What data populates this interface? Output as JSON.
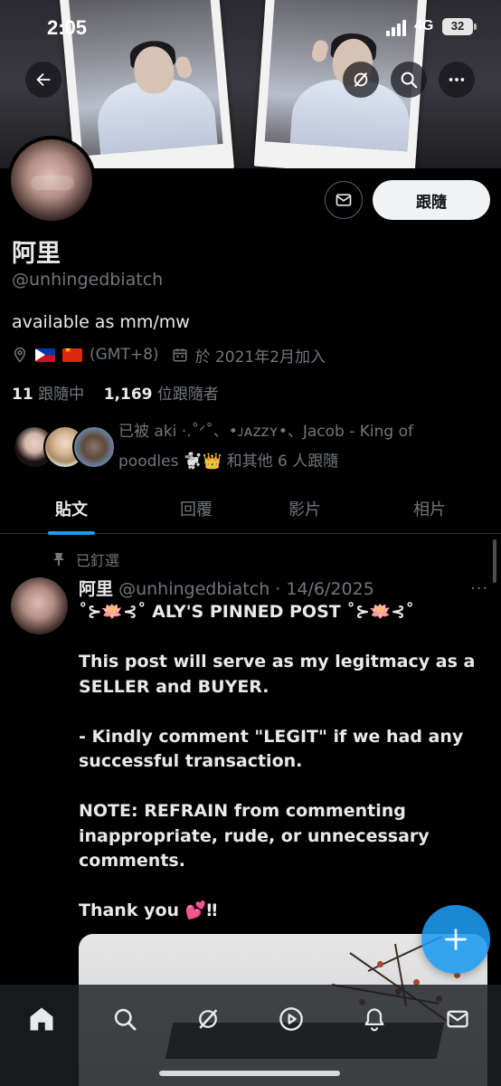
{
  "status_bar": {
    "time": "2:05",
    "network": "4G",
    "battery": "32"
  },
  "header": {
    "back_icon": "arrow-left-icon",
    "grok_icon": "grok-slash-icon",
    "search_icon": "search-icon",
    "more_icon": "more-horizontal-icon"
  },
  "profile": {
    "name": "阿里",
    "handle": "@unhingedbiatch",
    "bio": "available as mm/mw",
    "timezone": "(GMT+8)",
    "joined": "於 2021年2月加入",
    "following_count": "11",
    "following_label": "跟隨中",
    "followers_count": "1,169",
    "followers_label": "位跟隨者",
    "followed_by_line1": "已被 aki ·.˚ᐟ˚、•ᴊᴀᴢᴢʏ•、Jacob - King of",
    "followed_by_line2": "poodles 🐩👑 和其他 6 人跟隨",
    "follow_button": "跟隨"
  },
  "tabs": [
    {
      "label": "貼文",
      "active": true
    },
    {
      "label": "回覆",
      "active": false
    },
    {
      "label": "影片",
      "active": false
    },
    {
      "label": "相片",
      "active": false
    }
  ],
  "post": {
    "pinned_label": "已釘選",
    "author_name": "阿里",
    "author_meta": "@unhingedbiatch · 14/6/2025",
    "more": "···",
    "body": "˚⊱🪷⊰˚ ALY'S PINNED POST ˚⊱🪷⊰˚\n\nThis post will serve as my legitmacy as a SELLER and BUYER.\n\n- Kindly comment \"LEGIT\" if we had any successful transaction.\n\nNOTE: REFRAIN from commenting inappropriate, rude, or unnecessary comments.\n\nThank you 💕‼"
  },
  "bottom_nav": [
    "home-icon",
    "search-icon",
    "grok-icon",
    "video-play-icon",
    "bell-icon",
    "mail-icon"
  ],
  "fab_icon": "plus-icon",
  "colors": {
    "accent": "#1d9bf0",
    "background": "#000000",
    "text": "#e7e9ea",
    "muted": "#71767b"
  }
}
